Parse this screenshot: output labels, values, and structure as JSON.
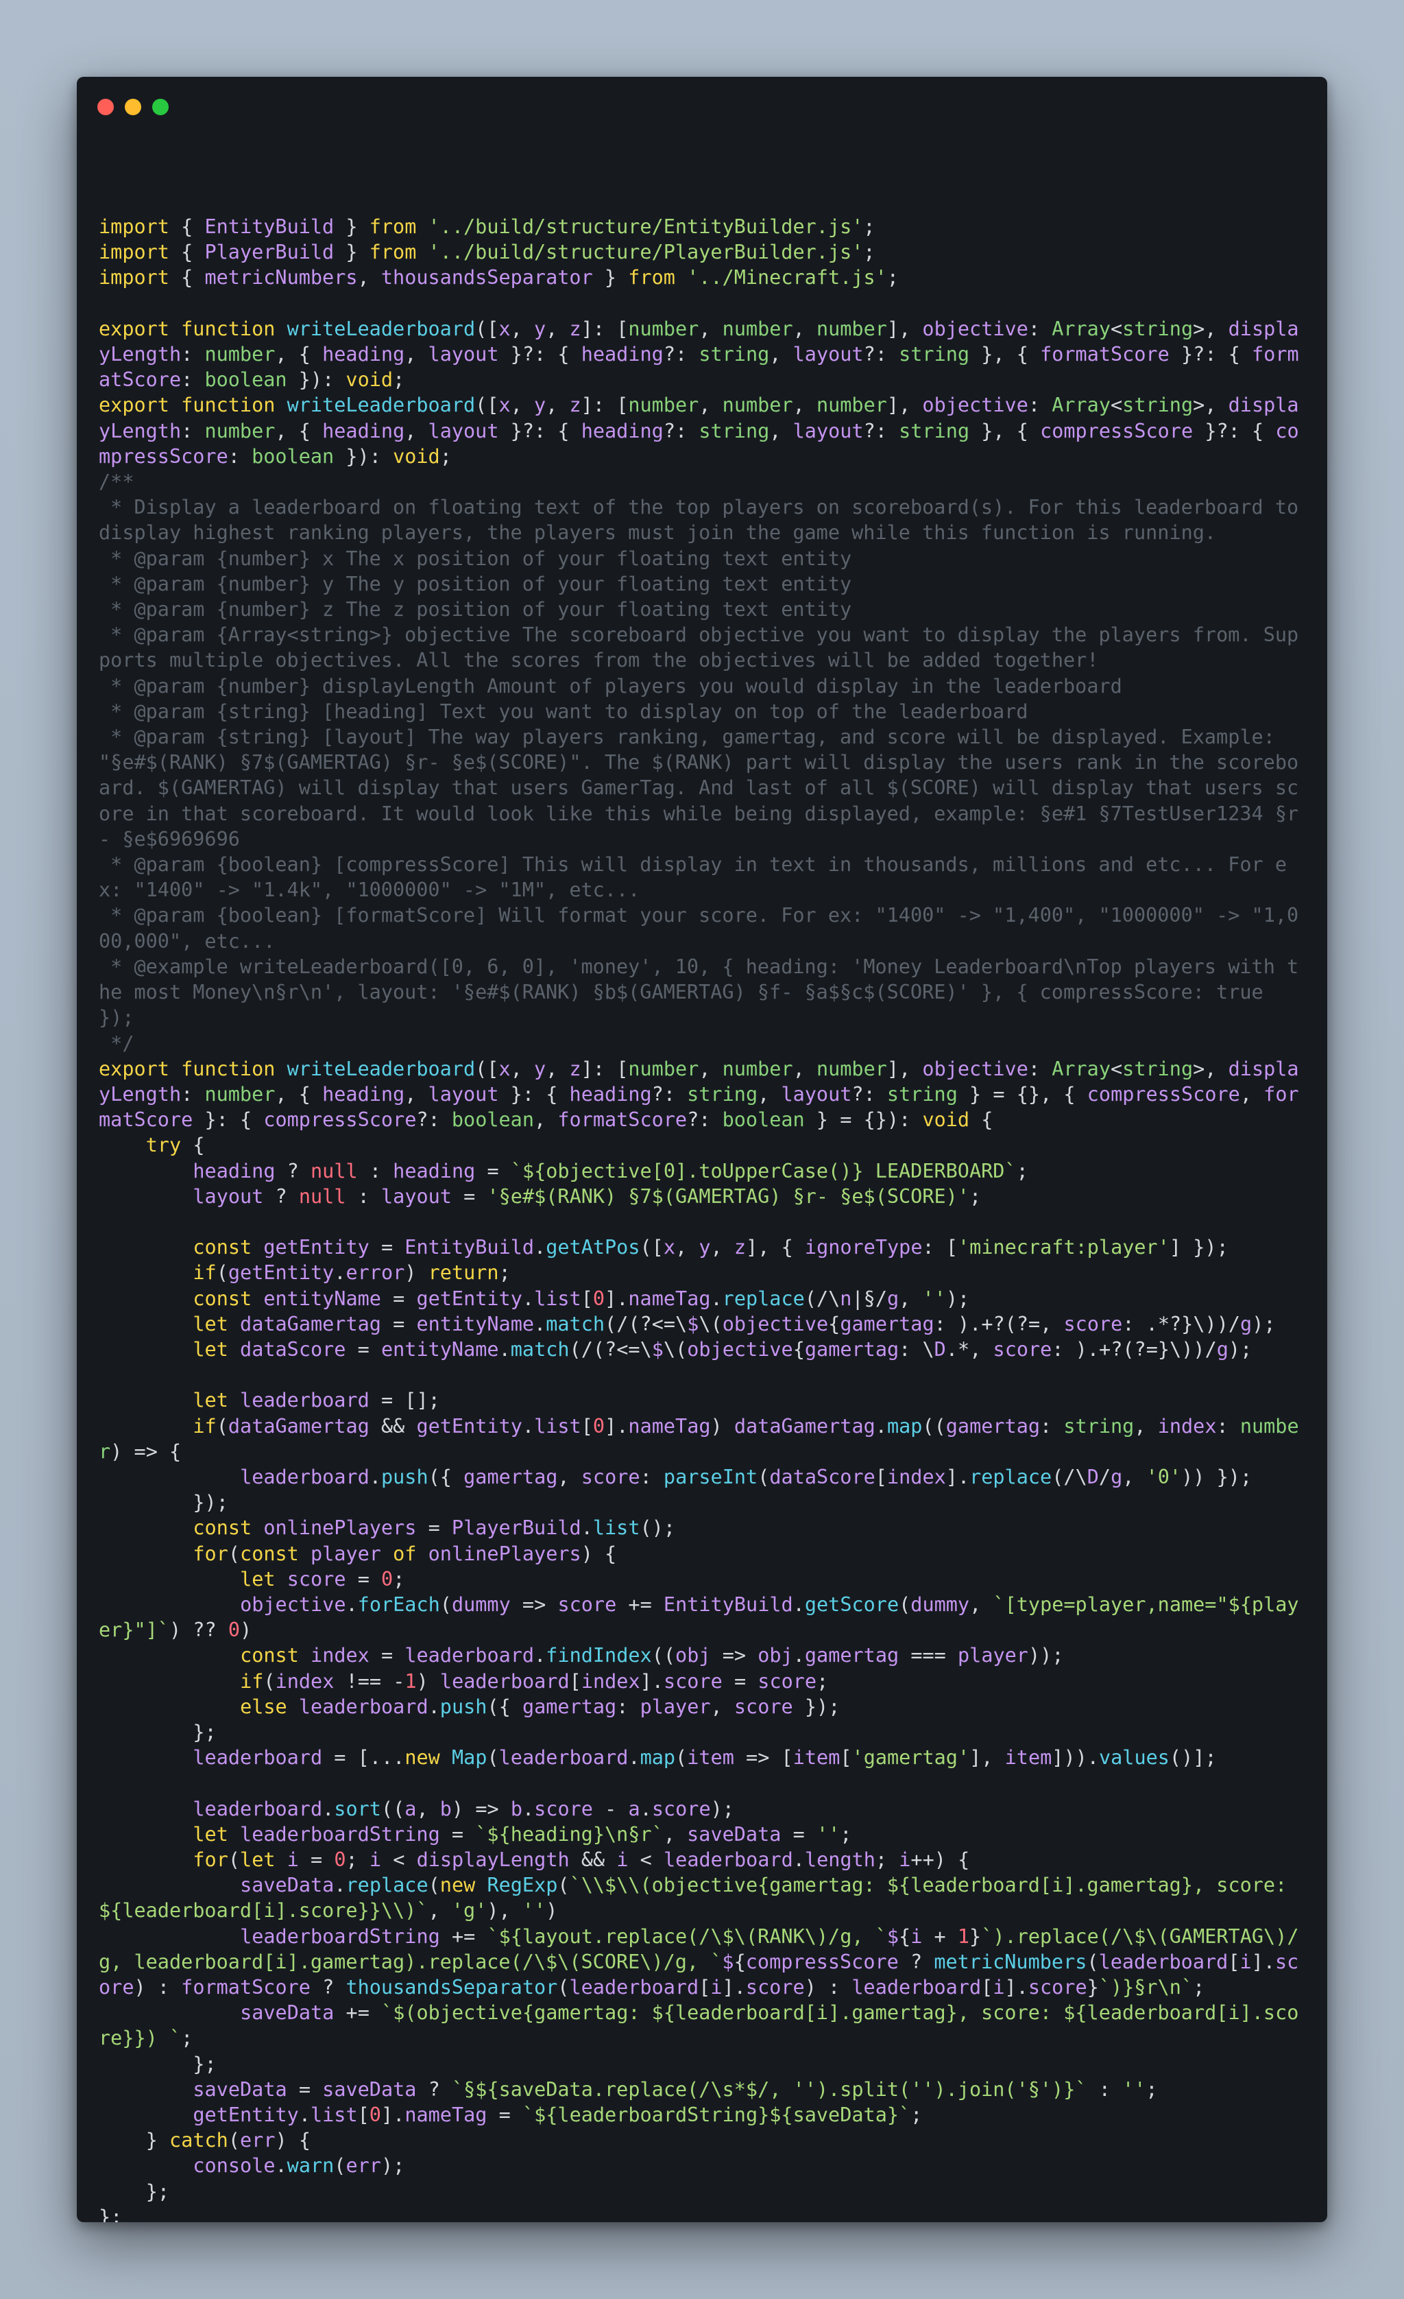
{
  "window": {
    "controls": [
      "close",
      "minimize",
      "maximize"
    ],
    "colors": {
      "close": "#ff5f57",
      "minimize": "#febc2e",
      "maximize": "#28c840",
      "background": "#161a1f"
    }
  },
  "code": {
    "language": "typescript",
    "lines": [
      "import { EntityBuild } from '../build/structure/EntityBuilder.js';",
      "import { PlayerBuild } from '../build/structure/PlayerBuilder.js';",
      "import { metricNumbers, thousandsSeparator } from '../Minecraft.js';",
      "",
      "export function writeLeaderboard([x, y, z]: [number, number, number], objective: Array<string>, displayLength: number, { heading, layout }?: { heading?: string, layout?: string }, { formatScore }?: { formatScore: boolean }): void;",
      "export function writeLeaderboard([x, y, z]: [number, number, number], objective: Array<string>, displayLength: number, { heading, layout }?: { heading?: string, layout?: string }, { compressScore }?: { compressScore: boolean }): void;",
      "/**",
      " * Display a leaderboard on floating text of the top players on scoreboard(s). For this leaderboard to display highest ranking players, the players must join the game while this function is running.",
      " * @param {number} x The x position of your floating text entity",
      " * @param {number} y The y position of your floating text entity",
      " * @param {number} z The z position of your floating text entity",
      " * @param {Array<string>} objective The scoreboard objective you want to display the players from. Supports multiple objectives. All the scores from the objectives will be added together!",
      " * @param {number} displayLength Amount of players you would display in the leaderboard",
      " * @param {string} [heading] Text you want to display on top of the leaderboard",
      " * @param {string} [layout] The way players ranking, gamertag, and score will be displayed. Example: \"§e#$(RANK) §7$(GAMERTAG) §r- §e$(SCORE)\". The $(RANK) part will display the users rank in the scoreboard. $(GAMERTAG) will display that users GamerTag. And last of all $(SCORE) will display that users score in that scoreboard. It would look like this while being displayed, example: §e#1 §7TestUser1234 §r- §e$6969696",
      " * @param {boolean} [compressScore] This will display in text in thousands, millions and etc... For ex: \"1400\" -> \"1.4k\", \"1000000\" -> \"1M\", etc...",
      " * @param {boolean} [formatScore] Will format your score. For ex: \"1400\" -> \"1,400\", \"1000000\" -> \"1,000,000\", etc...",
      " * @example writeLeaderboard([0, 6, 0], 'money', 10, { heading: 'Money Leaderboard\\nTop players with the most Money\\n§r\\n', layout: '§e#$(RANK) §b$(GAMERTAG) §f- §a$§c$(SCORE)' }, { compressScore: true });",
      " */",
      "export function writeLeaderboard([x, y, z]: [number, number, number], objective: Array<string>, displayLength: number, { heading, layout }: { heading?: string, layout?: string } = {}, { compressScore, formatScore }: { compressScore?: boolean, formatScore?: boolean } = {}): void {",
      "    try {",
      "        heading ? null : heading = `${objective[0].toUpperCase()} LEADERBOARD`;",
      "        layout ? null : layout = '§e#$(RANK) §7$(GAMERTAG) §r- §e$(SCORE)';",
      "",
      "        const getEntity = EntityBuild.getAtPos([x, y, z], { ignoreType: ['minecraft:player'] });",
      "        if(getEntity.error) return;",
      "        const entityName = getEntity.list[0].nameTag.replace(/\\n|§/g, '');",
      "        let dataGamertag = entityName.match(/(?<=\\$\\(objective{gamertag: ).+?(?=, score: .*?}\\))/g);",
      "        let dataScore = entityName.match(/(?<=\\$\\(objective{gamertag: \\D.*, score: ).+?(?=}\\))/g);",
      "",
      "        let leaderboard = [];",
      "        if(dataGamertag && getEntity.list[0].nameTag) dataGamertag.map((gamertag: string, index: number) => {",
      "            leaderboard.push({ gamertag, score: parseInt(dataScore[index].replace(/\\D/g, '0')) });",
      "        });",
      "        const onlinePlayers = PlayerBuild.list();",
      "        for(const player of onlinePlayers) {",
      "            let score = 0;",
      "            objective.forEach(dummy => score += EntityBuild.getScore(dummy, `[type=player,name=\"${player}\"]`) ?? 0)",
      "            const index = leaderboard.findIndex((obj => obj.gamertag === player));",
      "            if(index !== -1) leaderboard[index].score = score;",
      "            else leaderboard.push({ gamertag: player, score });",
      "        };",
      "        leaderboard = [...new Map(leaderboard.map(item => [item['gamertag'], item])).values()];",
      "",
      "        leaderboard.sort((a, b) => b.score - a.score);",
      "        let leaderboardString = `${heading}\\n§r`, saveData = '';",
      "        for(let i = 0; i < displayLength && i < leaderboard.length; i++) {",
      "            saveData.replace(new RegExp(`\\\\$\\\\(objective{gamertag: ${leaderboard[i].gamertag}, score: ${leaderboard[i].score}}\\\\)`, 'g'), '')",
      "            leaderboardString += `${layout.replace(/\\$\\(RANK\\)/g, `${i + 1}`).replace(/\\$\\(GAMERTAG\\)/g, leaderboard[i].gamertag).replace(/\\$\\(SCORE\\)/g, `${compressScore ? metricNumbers(leaderboard[i].score) : formatScore ? thousandsSeparator(leaderboard[i].score) : leaderboard[i].score}`)}§r\\n`;",
      "            saveData += `$(objective{gamertag: ${leaderboard[i].gamertag}, score: ${leaderboard[i].score}}) `;",
      "        };",
      "        saveData = saveData ? `§${saveData.replace(/\\s*$/, '').split('').join('§')}` : '';",
      "        getEntity.list[0].nameTag = `${leaderboardString}${saveData}`;",
      "    } catch(err) {",
      "        console.warn(err);",
      "    };",
      "};"
    ]
  }
}
